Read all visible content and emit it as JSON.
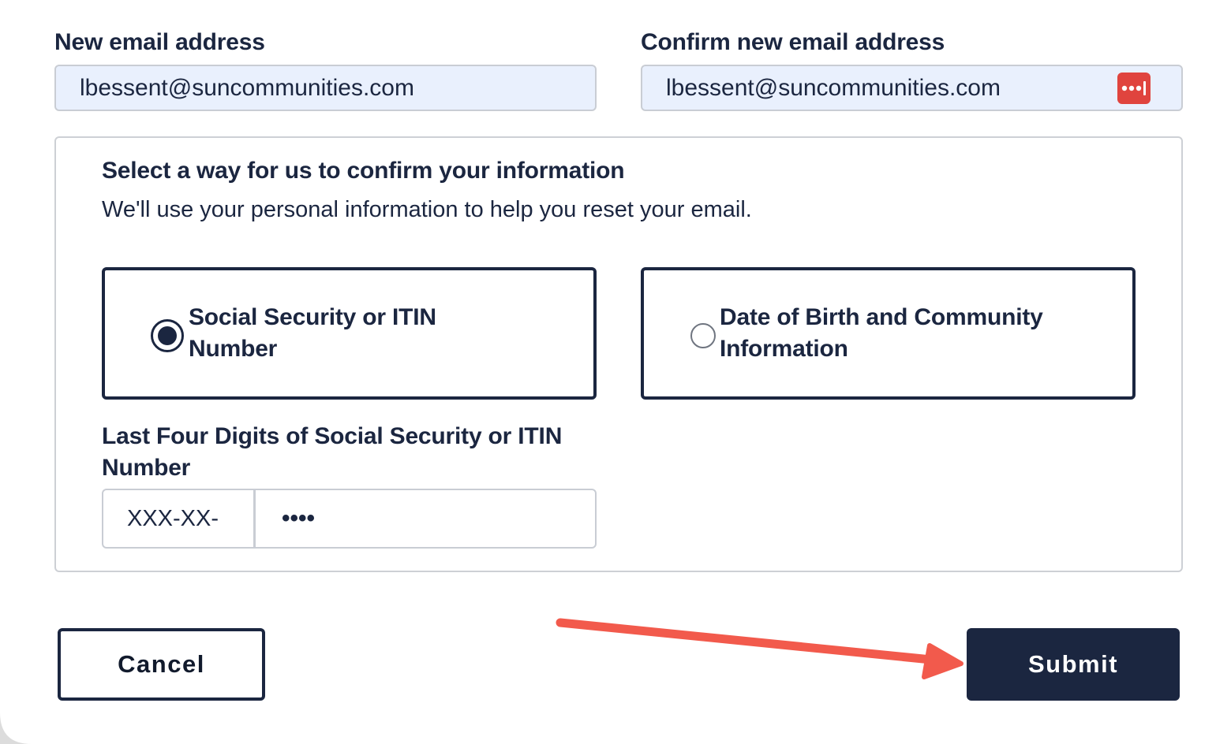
{
  "email": {
    "new_label": "New email address",
    "new_value": "lbessent@suncommunities.com",
    "confirm_label": "Confirm new email address",
    "confirm_value": "lbessent@suncommunities.com",
    "password_manager_icon": "password-manager-icon"
  },
  "verification": {
    "title": "Select a way for us to confirm your information",
    "description": "We'll use your personal information to help you reset your email.",
    "options": [
      {
        "label": "Social Security or ITIN Number",
        "selected": true
      },
      {
        "label": "Date of Birth and Community Information",
        "selected": false
      }
    ]
  },
  "ssn": {
    "label": "Last Four Digits of Social Security or ITIN Number",
    "prefix": "XXX-XX-",
    "value": "••••"
  },
  "actions": {
    "cancel_label": "Cancel",
    "submit_label": "Submit"
  },
  "colors": {
    "navy": "#1b2640",
    "autofill_bg": "#e9f0fd",
    "annotation_arrow": "#f25a4c",
    "password_manager": "#e0443e"
  }
}
